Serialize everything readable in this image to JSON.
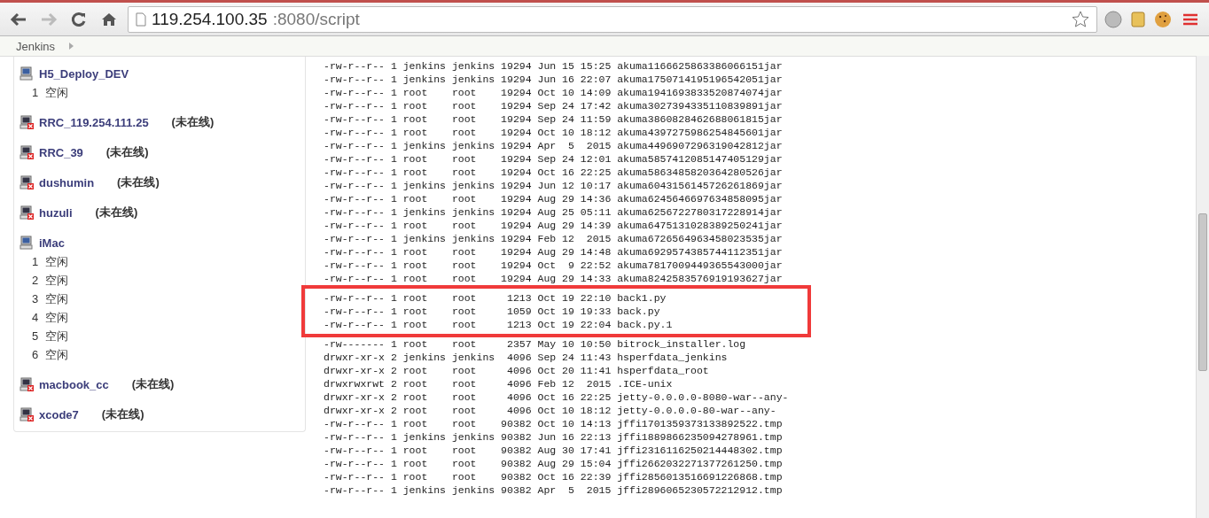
{
  "browser": {
    "url_host": "119.254.100.35",
    "url_rest": ":8080/script"
  },
  "breadcrumb": {
    "items": [
      {
        "label": "Jenkins"
      }
    ]
  },
  "nodes": [
    {
      "name": "H5_Deploy_DEV",
      "offline": false,
      "executors": [
        {
          "number": "1",
          "state": "空闲"
        }
      ]
    },
    {
      "name": "RRC_119.254.111.25",
      "offline": true,
      "status": "(未在线)"
    },
    {
      "name": "RRC_39",
      "offline": true,
      "status": "(未在线)"
    },
    {
      "name": "dushumin",
      "offline": true,
      "status": "(未在线)"
    },
    {
      "name": "huzuli",
      "offline": true,
      "status": "(未在线)"
    },
    {
      "name": "iMac",
      "offline": false,
      "executors": [
        {
          "number": "1",
          "state": "空闲"
        },
        {
          "number": "2",
          "state": "空闲"
        },
        {
          "number": "3",
          "state": "空闲"
        },
        {
          "number": "4",
          "state": "空闲"
        },
        {
          "number": "5",
          "state": "空闲"
        },
        {
          "number": "6",
          "state": "空闲"
        }
      ]
    },
    {
      "name": "macbook_cc",
      "offline": true,
      "status": "(未在线)"
    },
    {
      "name": "xcode7",
      "offline": true,
      "status": "(未在线)"
    }
  ],
  "listing": [
    {
      "perms": "-rw-r--r--",
      "links": "1",
      "owner": "jenkins",
      "group": "jenkins",
      "size": "19294",
      "date": "Jun 15 15:25",
      "name": "akuma1166625863386066151jar",
      "highlighted": false
    },
    {
      "perms": "-rw-r--r--",
      "links": "1",
      "owner": "jenkins",
      "group": "jenkins",
      "size": "19294",
      "date": "Jun 16 22:07",
      "name": "akuma1750714195196542051jar",
      "highlighted": false
    },
    {
      "perms": "-rw-r--r--",
      "links": "1",
      "owner": "root",
      "group": "root",
      "size": "19294",
      "date": "Oct 10 14:09",
      "name": "akuma1941693833520874074jar",
      "highlighted": false
    },
    {
      "perms": "-rw-r--r--",
      "links": "1",
      "owner": "root",
      "group": "root",
      "size": "19294",
      "date": "Sep 24 17:42",
      "name": "akuma3027394335110839891jar",
      "highlighted": false
    },
    {
      "perms": "-rw-r--r--",
      "links": "1",
      "owner": "root",
      "group": "root",
      "size": "19294",
      "date": "Sep 24 11:59",
      "name": "akuma3860828462688061815jar",
      "highlighted": false
    },
    {
      "perms": "-rw-r--r--",
      "links": "1",
      "owner": "root",
      "group": "root",
      "size": "19294",
      "date": "Oct 10 18:12",
      "name": "akuma4397275986254845601jar",
      "highlighted": false
    },
    {
      "perms": "-rw-r--r--",
      "links": "1",
      "owner": "jenkins",
      "group": "jenkins",
      "size": "19294",
      "date": "Apr  5  2015",
      "name": "akuma4496907296319042812jar",
      "highlighted": false
    },
    {
      "perms": "-rw-r--r--",
      "links": "1",
      "owner": "root",
      "group": "root",
      "size": "19294",
      "date": "Sep 24 12:01",
      "name": "akuma5857412085147405129jar",
      "highlighted": false
    },
    {
      "perms": "-rw-r--r--",
      "links": "1",
      "owner": "root",
      "group": "root",
      "size": "19294",
      "date": "Oct 16 22:25",
      "name": "akuma5863485820364280526jar",
      "highlighted": false
    },
    {
      "perms": "-rw-r--r--",
      "links": "1",
      "owner": "jenkins",
      "group": "jenkins",
      "size": "19294",
      "date": "Jun 12 10:17",
      "name": "akuma6043156145726261869jar",
      "highlighted": false
    },
    {
      "perms": "-rw-r--r--",
      "links": "1",
      "owner": "root",
      "group": "root",
      "size": "19294",
      "date": "Aug 29 14:36",
      "name": "akuma6245646697634858095jar",
      "highlighted": false
    },
    {
      "perms": "-rw-r--r--",
      "links": "1",
      "owner": "jenkins",
      "group": "jenkins",
      "size": "19294",
      "date": "Aug 25 05:11",
      "name": "akuma6256722780317228914jar",
      "highlighted": false
    },
    {
      "perms": "-rw-r--r--",
      "links": "1",
      "owner": "root",
      "group": "root",
      "size": "19294",
      "date": "Aug 29 14:39",
      "name": "akuma6475131028389250241jar",
      "highlighted": false
    },
    {
      "perms": "-rw-r--r--",
      "links": "1",
      "owner": "jenkins",
      "group": "jenkins",
      "size": "19294",
      "date": "Feb 12  2015",
      "name": "akuma6726564963458023535jar",
      "highlighted": false
    },
    {
      "perms": "-rw-r--r--",
      "links": "1",
      "owner": "root",
      "group": "root",
      "size": "19294",
      "date": "Aug 29 14:48",
      "name": "akuma6929574385744112351jar",
      "highlighted": false
    },
    {
      "perms": "-rw-r--r--",
      "links": "1",
      "owner": "root",
      "group": "root",
      "size": "19294",
      "date": "Oct  9 22:52",
      "name": "akuma7817009449365543000jar",
      "highlighted": false
    },
    {
      "perms": "-rw-r--r--",
      "links": "1",
      "owner": "root",
      "group": "root",
      "size": "19294",
      "date": "Aug 29 14:33",
      "name": "akuma8242583576919193627jar",
      "highlighted": false
    },
    {
      "perms": "-rw-r--r--",
      "links": "1",
      "owner": "root",
      "group": "root",
      "size": "1213",
      "date": "Oct 19 22:10",
      "name": "back1.py",
      "highlighted": true
    },
    {
      "perms": "-rw-r--r--",
      "links": "1",
      "owner": "root",
      "group": "root",
      "size": "1059",
      "date": "Oct 19 19:33",
      "name": "back.py",
      "highlighted": true
    },
    {
      "perms": "-rw-r--r--",
      "links": "1",
      "owner": "root",
      "group": "root",
      "size": "1213",
      "date": "Oct 19 22:04",
      "name": "back.py.1",
      "highlighted": true
    },
    {
      "perms": "-rw-------",
      "links": "1",
      "owner": "root",
      "group": "root",
      "size": "2357",
      "date": "May 10 10:50",
      "name": "bitrock_installer.log",
      "highlighted": false
    },
    {
      "perms": "drwxr-xr-x",
      "links": "2",
      "owner": "jenkins",
      "group": "jenkins",
      "size": "4096",
      "date": "Sep 24 11:43",
      "name": "hsperfdata_jenkins",
      "highlighted": false
    },
    {
      "perms": "drwxr-xr-x",
      "links": "2",
      "owner": "root",
      "group": "root",
      "size": "4096",
      "date": "Oct 20 11:41",
      "name": "hsperfdata_root",
      "highlighted": false
    },
    {
      "perms": "drwxrwxrwt",
      "links": "2",
      "owner": "root",
      "group": "root",
      "size": "4096",
      "date": "Feb 12  2015",
      "name": ".ICE-unix",
      "highlighted": false
    },
    {
      "perms": "drwxr-xr-x",
      "links": "2",
      "owner": "root",
      "group": "root",
      "size": "4096",
      "date": "Oct 16 22:25",
      "name": "jetty-0.0.0.0-8080-war--any-",
      "highlighted": false
    },
    {
      "perms": "drwxr-xr-x",
      "links": "2",
      "owner": "root",
      "group": "root",
      "size": "4096",
      "date": "Oct 10 18:12",
      "name": "jetty-0.0.0.0-80-war--any-",
      "highlighted": false
    },
    {
      "perms": "-rw-r--r--",
      "links": "1",
      "owner": "root",
      "group": "root",
      "size": "90382",
      "date": "Oct 10 14:13",
      "name": "jffi1701359373133892522.tmp",
      "highlighted": false
    },
    {
      "perms": "-rw-r--r--",
      "links": "1",
      "owner": "jenkins",
      "group": "jenkins",
      "size": "90382",
      "date": "Jun 16 22:13",
      "name": "jffi1889866235094278961.tmp",
      "highlighted": false
    },
    {
      "perms": "-rw-r--r--",
      "links": "1",
      "owner": "root",
      "group": "root",
      "size": "90382",
      "date": "Aug 30 17:41",
      "name": "jffi2316116250214448302.tmp",
      "highlighted": false
    },
    {
      "perms": "-rw-r--r--",
      "links": "1",
      "owner": "root",
      "group": "root",
      "size": "90382",
      "date": "Aug 29 15:04",
      "name": "jffi2662032271377261250.tmp",
      "highlighted": false
    },
    {
      "perms": "-rw-r--r--",
      "links": "1",
      "owner": "root",
      "group": "root",
      "size": "90382",
      "date": "Oct 16 22:39",
      "name": "jffi2856013516691226868.tmp",
      "highlighted": false
    },
    {
      "perms": "-rw-r--r--",
      "links": "1",
      "owner": "jenkins",
      "group": "jenkins",
      "size": "90382",
      "date": "Apr  5  2015",
      "name": "jffi2896065230572212912.tmp",
      "highlighted": false
    }
  ]
}
